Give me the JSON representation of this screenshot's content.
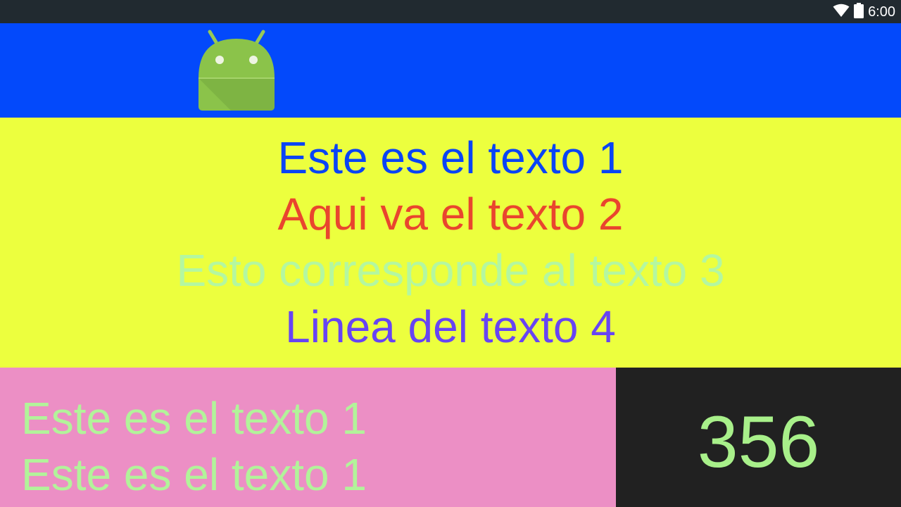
{
  "status_bar": {
    "time": "6:00",
    "icons": [
      "wifi-icon",
      "battery-icon"
    ]
  },
  "header": {
    "background": "#0349fb",
    "logo": "android-robot-logo"
  },
  "center_panel": {
    "background": "#ecff3e",
    "lines": [
      {
        "text": "Este es el texto 1",
        "color": "#0a44f5"
      },
      {
        "text": "Aqui va el texto 2",
        "color": "#e9452e"
      },
      {
        "text": "Esto corresponde al texto 3",
        "color": "#b4f7a0"
      },
      {
        "text": "Linea del texto 4",
        "color": "#6744f3"
      }
    ]
  },
  "bottom_left": {
    "background": "#ec8fc5",
    "lines": [
      {
        "text": "Este es el texto 1"
      },
      {
        "text": "Este es el texto 1"
      }
    ]
  },
  "bottom_right": {
    "background": "#212121",
    "value": "356"
  }
}
